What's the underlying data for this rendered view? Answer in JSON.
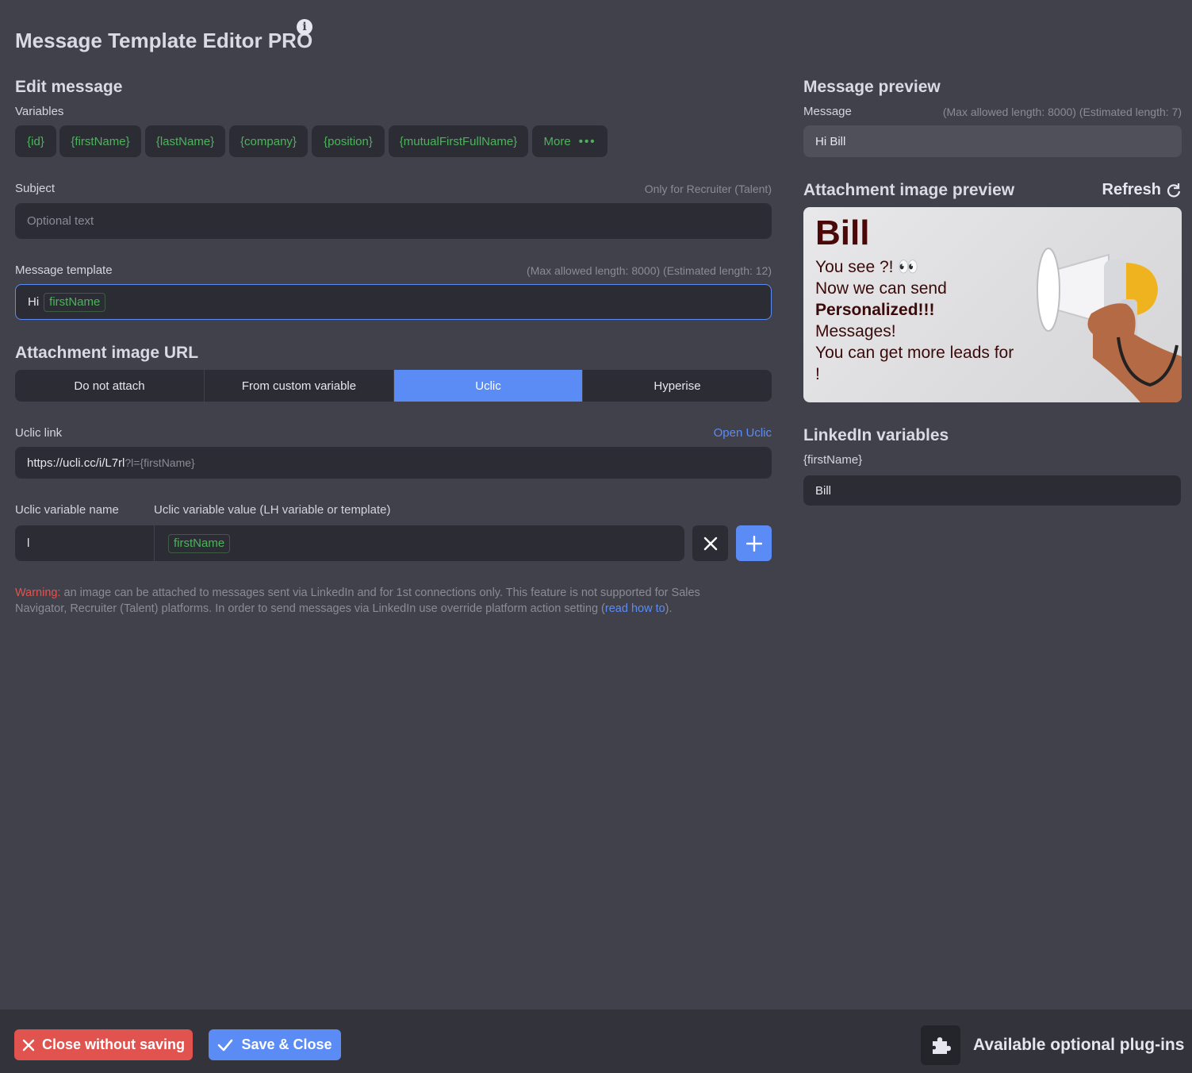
{
  "app": {
    "title": "Message Template Editor PRO"
  },
  "edit": {
    "heading": "Edit message",
    "variables_label": "Variables",
    "variables": [
      "{id}",
      "{firstName}",
      "{lastName}",
      "{company}",
      "{position}",
      "{mutualFirstFullName}"
    ],
    "more_label": "More",
    "subject_label": "Subject",
    "subject_hint": "Only for Recruiter (Talent)",
    "subject_placeholder": "Optional text",
    "template_label": "Message template",
    "template_hint": "(Max allowed length: 8000) (Estimated length: 12)",
    "template_text": "Hi",
    "template_tag": "firstName"
  },
  "attachment": {
    "heading": "Attachment image URL",
    "options": [
      "Do not attach",
      "From custom variable",
      "Uclic",
      "Hyperise"
    ],
    "selected": "Uclic",
    "link_label": "Uclic link",
    "open_link": "Open Uclic",
    "link_value": "https://ucli.cc/i/L7rl",
    "link_suffix": "?l={firstName}",
    "var_name_label": "Uclic variable name",
    "var_value_label": "Uclic variable value (LH variable or template)",
    "var_name_value": "l",
    "var_value_tag": "firstName",
    "warning_prefix": "Warning:",
    "warning_text": " an image can be attached to messages sent via LinkedIn and for 1st connections only. This feature is not supported for Sales Navigator, Recruiter (Talent) platforms. In order to send messages via LinkedIn use override platform action setting (",
    "warning_link": "read how to",
    "warning_end": ")."
  },
  "preview": {
    "heading": "Message preview",
    "message_label": "Message",
    "message_hint": "(Max allowed length: 8000) (Estimated length: 7)",
    "message_value": "Hi Bill",
    "image_heading": "Attachment image preview",
    "refresh_label": "Refresh",
    "image_name": "Bill",
    "image_line1": "You see ?! 👀",
    "image_line2": "Now we can send",
    "image_line3": "Personalized!!!",
    "image_line4": "Messages!",
    "image_line5": "You can get more leads for",
    "image_line6": "!"
  },
  "linkedin": {
    "heading": "LinkedIn variables",
    "var_label": "{firstName}",
    "var_value": "Bill"
  },
  "footer": {
    "close_label": "Close without saving",
    "save_label": "Save & Close",
    "plugins_label": "Available optional plug-ins"
  },
  "colors": {
    "background": "#40414b",
    "field": "#2c2d34",
    "accent": "#5b8cf5",
    "danger": "#e0534f",
    "variable": "#4cb35b"
  }
}
